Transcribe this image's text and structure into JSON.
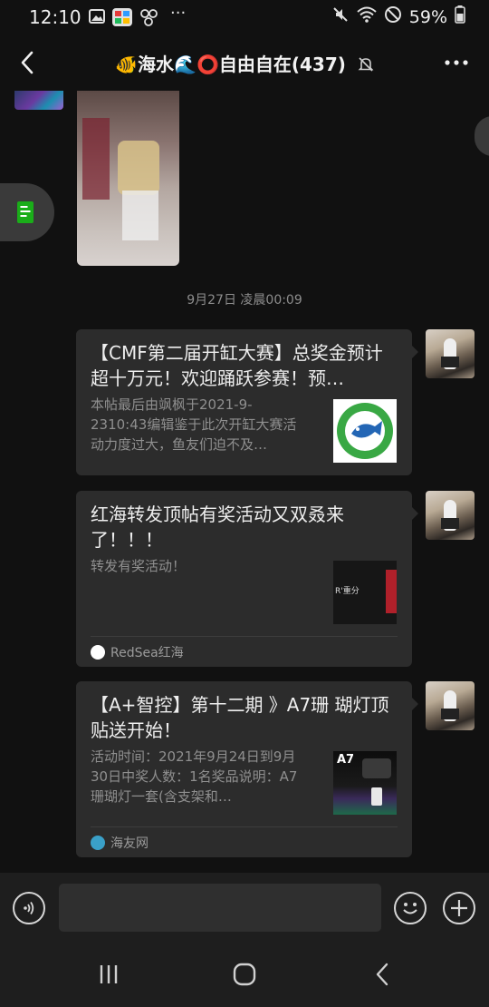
{
  "status_bar": {
    "time": "12:10",
    "battery": "59%",
    "left_icons": [
      "gallery-icon",
      "app-store-icon",
      "wechat-mini-icon",
      "more-dots-icon"
    ],
    "right_icons": [
      "mute-icon",
      "wifi-icon",
      "dnd-icon",
      "battery-icon"
    ]
  },
  "nav": {
    "title": "🐠海水🌊⭕自由自在(437)"
  },
  "messages": {
    "timestamp": "9月27日 凌晨00:09",
    "card1": {
      "title": "【CMF第二届开缸大赛】总奖金预计超十万元！欢迎踊跃参赛！预…",
      "desc": "本帖最后由飒枫于2021-9-2310:43编辑鉴于此次开缸大赛活动力度过大，鱼友们迫不及…"
    },
    "card2": {
      "title": "红海转发顶帖有奖活动又双叒来了！！！",
      "desc": "转发有奖活动！",
      "thumb_text": "R'重分",
      "source": "RedSea红海"
    },
    "card3": {
      "title": "【A+智控】第十二期 》A7珊 瑚灯顶贴送开始！",
      "desc": "活动时间：2021年9月24日到9月30日中奖人数：1名奖品说明：A7珊瑚灯一套(含支架和…",
      "thumb_text": "A7",
      "source": "海友网"
    }
  },
  "input": {
    "placeholder": ""
  },
  "colors": {
    "background": "#111111",
    "card": "#2c2c2c",
    "input_bar": "#1e1e1e"
  }
}
